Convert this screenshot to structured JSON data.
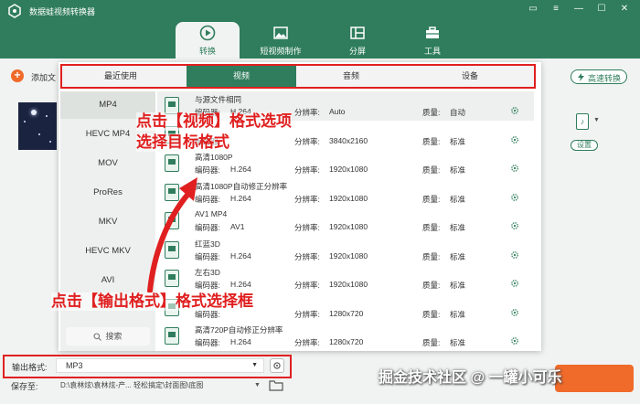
{
  "app": {
    "title": "数据蛙视频转换器"
  },
  "window_controls": [
    "minimize-to-tray",
    "menu",
    "minimize",
    "maximize",
    "close"
  ],
  "nav_tabs": [
    {
      "label": "转换",
      "icon": "convert-icon",
      "active": true
    },
    {
      "label": "短视频制作",
      "icon": "image-icon",
      "active": false
    },
    {
      "label": "分屏",
      "icon": "split-icon",
      "active": false
    },
    {
      "label": "工具",
      "icon": "toolbox-icon",
      "active": false
    }
  ],
  "add_file": {
    "label": "添加文"
  },
  "fast_convert": {
    "label": "高速转换"
  },
  "settings_button": {
    "label": "设置"
  },
  "format_panel": {
    "tabs": [
      {
        "label": "最近使用",
        "active": false
      },
      {
        "label": "视频",
        "active": true
      },
      {
        "label": "音频",
        "active": false
      },
      {
        "label": "设备",
        "active": false
      }
    ],
    "formats": [
      {
        "label": "MP4",
        "active": true
      },
      {
        "label": "HEVC MP4",
        "active": false
      },
      {
        "label": "MOV",
        "active": false
      },
      {
        "label": "ProRes",
        "active": false
      },
      {
        "label": "MKV",
        "active": false
      },
      {
        "label": "HEVC MKV",
        "active": false
      },
      {
        "label": "AVI",
        "active": false
      }
    ],
    "search_label": "搜索",
    "encoder_key": "编码器:",
    "resolution_key": "分辨率:",
    "quality_key": "质量:",
    "presets": [
      {
        "name": "与源文件相同",
        "encoder": "H.264",
        "resolution": "Auto",
        "quality": "自动"
      },
      {
        "name": "",
        "encoder": "",
        "resolution": "3840x2160",
        "quality": "标准"
      },
      {
        "name": "高清1080P",
        "encoder": "H.264",
        "resolution": "1920x1080",
        "quality": "标准"
      },
      {
        "name": "高清1080P自动修正分辨率",
        "encoder": "H.264",
        "resolution": "1920x1080",
        "quality": "标准"
      },
      {
        "name": "AV1 MP4",
        "encoder": "AV1",
        "resolution": "1920x1080",
        "quality": "标准"
      },
      {
        "name": "红蓝3D",
        "encoder": "H.264",
        "resolution": "1920x1080",
        "quality": "标准"
      },
      {
        "name": "左右3D",
        "encoder": "H.264",
        "resolution": "1920x1080",
        "quality": "标准"
      },
      {
        "name": "",
        "encoder": "",
        "resolution": "1280x720",
        "quality": "标准"
      },
      {
        "name": "高清720P自动修正分辨率",
        "encoder": "H.264",
        "resolution": "1280x720",
        "quality": "标准"
      }
    ]
  },
  "output": {
    "label": "输出格式:",
    "value": "MP3"
  },
  "save_to": {
    "label": "保存至:",
    "path": "D:\\袁林炫\\袁林炫-产... 轻松搞定\\封面图\\底图"
  },
  "annotations": {
    "video_tab_line1": "点击【视频】格式选项",
    "video_tab_line2": "选择目标格式",
    "output_format": "点击【输出格式】格式选择框"
  },
  "watermark": "掘金技术社区 @ 一罐小可乐",
  "colors": {
    "brand": "#2f7d5c",
    "accent": "#f06a2a",
    "annotation": "#e02020"
  }
}
